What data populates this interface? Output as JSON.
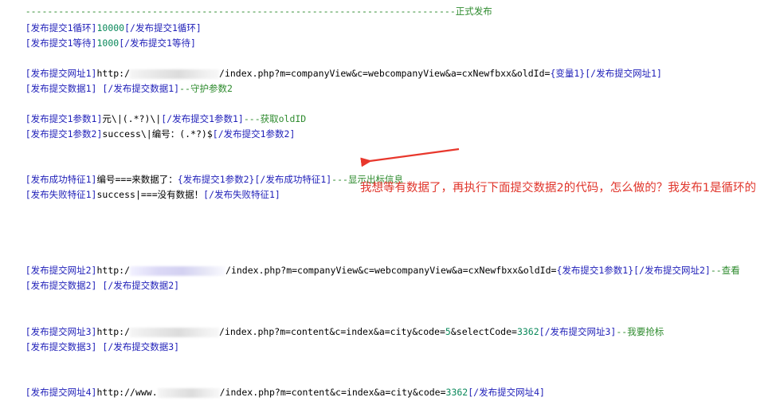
{
  "lines": {
    "l0": {
      "dashes": "------------------------------------------------------------------------------",
      "comment": "正式发布"
    },
    "l1": {
      "open": "[发布提交1循环]",
      "value": "10000",
      "close": "[/发布提交1循环]"
    },
    "l2": {
      "open": "[发布提交1等待]",
      "value": "1000",
      "close": "[/发布提交1等待]"
    },
    "l3": {
      "open": "[发布提交网址1]",
      "prefix": "http:/",
      "path": "/index.php?m=companyView&c=webcompanyView&a=cxNewfbxx&oldId=",
      "var": "{变量1}",
      "close": "[/发布提交网址1]"
    },
    "l4": {
      "open": "[发布提交数据1]",
      "close": " [/发布提交数据1]",
      "comment": "--守护参数2"
    },
    "l5": {
      "open": "[发布提交1参数1]",
      "text": "元\\|(.*?)\\|",
      "close": "[/发布提交1参数1]",
      "comment": "---获取oldID"
    },
    "l6": {
      "open": "[发布提交1参数2]",
      "text": "success\\|编号：(.*?)$",
      "close": "[/发布提交1参数2]"
    },
    "l7": {
      "open": "[发布成功特征1]",
      "text": "编号===来数据了：",
      "var": "{发布提交1参数2}",
      "close": "[/发布成功特征1]",
      "comment": "---显示出标信息"
    },
    "l8": {
      "open": "[发布失败特征1]",
      "text": "success|===没有数据！",
      "close": "[/发布失败特征1]"
    },
    "l9": {
      "open": "[发布提交网址2]",
      "prefix": "http:/",
      "path": "/index.php?m=companyView&c=webcompanyView&a=cxNewfbxx&oldId=",
      "var": "{发布提交1参数1}",
      "close": "[/发布提交网址2]",
      "comment": "--查看"
    },
    "l10": {
      "open": "[发布提交数据2]",
      "close": " [/发布提交数据2]"
    },
    "l11": {
      "open": "[发布提交网址3]",
      "prefix": "http:/",
      "path": "/index.php?m=content&c=index&a=city&code=",
      "num1": "5",
      "mid": "&selectCode=",
      "num2": "3362",
      "close": "[/发布提交网址3]",
      "comment": "--我要抢标"
    },
    "l12": {
      "open": "[发布提交数据3]",
      "close": " [/发布提交数据3]"
    },
    "l13": {
      "open": "[发布提交网址4]",
      "prefix": "http://www.",
      "path": "/index.php?m=content&c=index&a=city&code=",
      "num": "3362",
      "close": "[/发布提交网址4]"
    }
  },
  "annotation": {
    "text": "我想等有数据了，再执行下面提交数据2的代码，怎么做的？我发布1是循环的",
    "color": "#e0352b"
  },
  "colors": {
    "tag": "#1f1fb8",
    "number": "#09885a",
    "comment": "#2e8b2e",
    "text": "#000000"
  }
}
